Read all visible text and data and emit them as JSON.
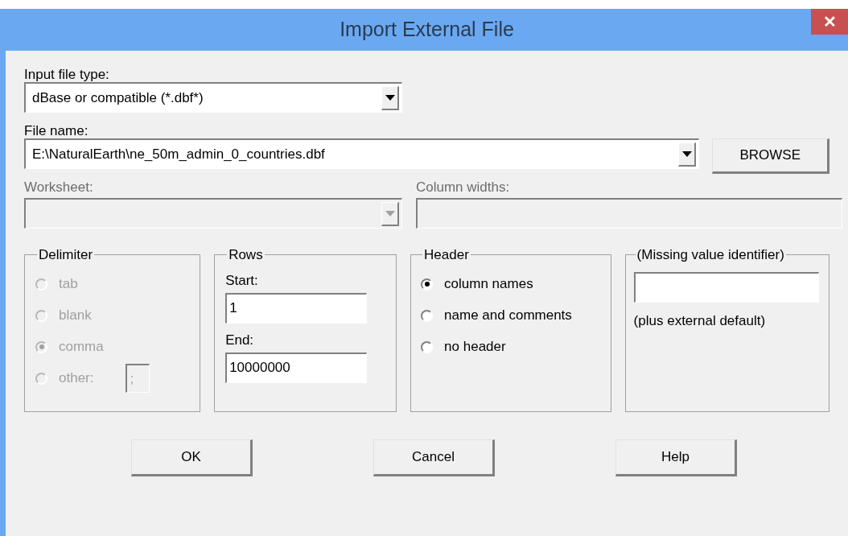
{
  "window": {
    "title": "Import External File",
    "close": "✕"
  },
  "input_file_type": {
    "label": "Input file type:",
    "value": "dBase or compatible (*.dbf*)",
    "disabled": false
  },
  "file_name": {
    "label": "File name:",
    "value": "E:\\NaturalEarth\\ne_50m_admin_0_countries.dbf",
    "disabled": false
  },
  "browse_button": "BROWSE",
  "worksheet": {
    "label": "Worksheet:",
    "disabled": true
  },
  "column_widths": {
    "label": "Column widths:",
    "disabled": true
  },
  "delimiter": {
    "title": "Delimiter",
    "disabled": true,
    "options": [
      {
        "label": "tab",
        "selected": false
      },
      {
        "label": "blank",
        "selected": false
      },
      {
        "label": "comma",
        "selected": true
      },
      {
        "label": "other:",
        "selected": false,
        "value": ";"
      }
    ]
  },
  "rows": {
    "title": "Rows",
    "start_label": "Start:",
    "start": "1",
    "end_label": "End:",
    "end": "10000000"
  },
  "header": {
    "title": "Header",
    "disabled": false,
    "options": [
      {
        "label": "column names",
        "selected": true
      },
      {
        "label": "name and comments",
        "selected": false
      },
      {
        "label": "no header",
        "selected": false
      }
    ]
  },
  "missing_value": {
    "title": "(Missing value identifier)",
    "note": "(plus external default)"
  },
  "buttons": [
    "OK",
    "Cancel",
    "Help"
  ]
}
